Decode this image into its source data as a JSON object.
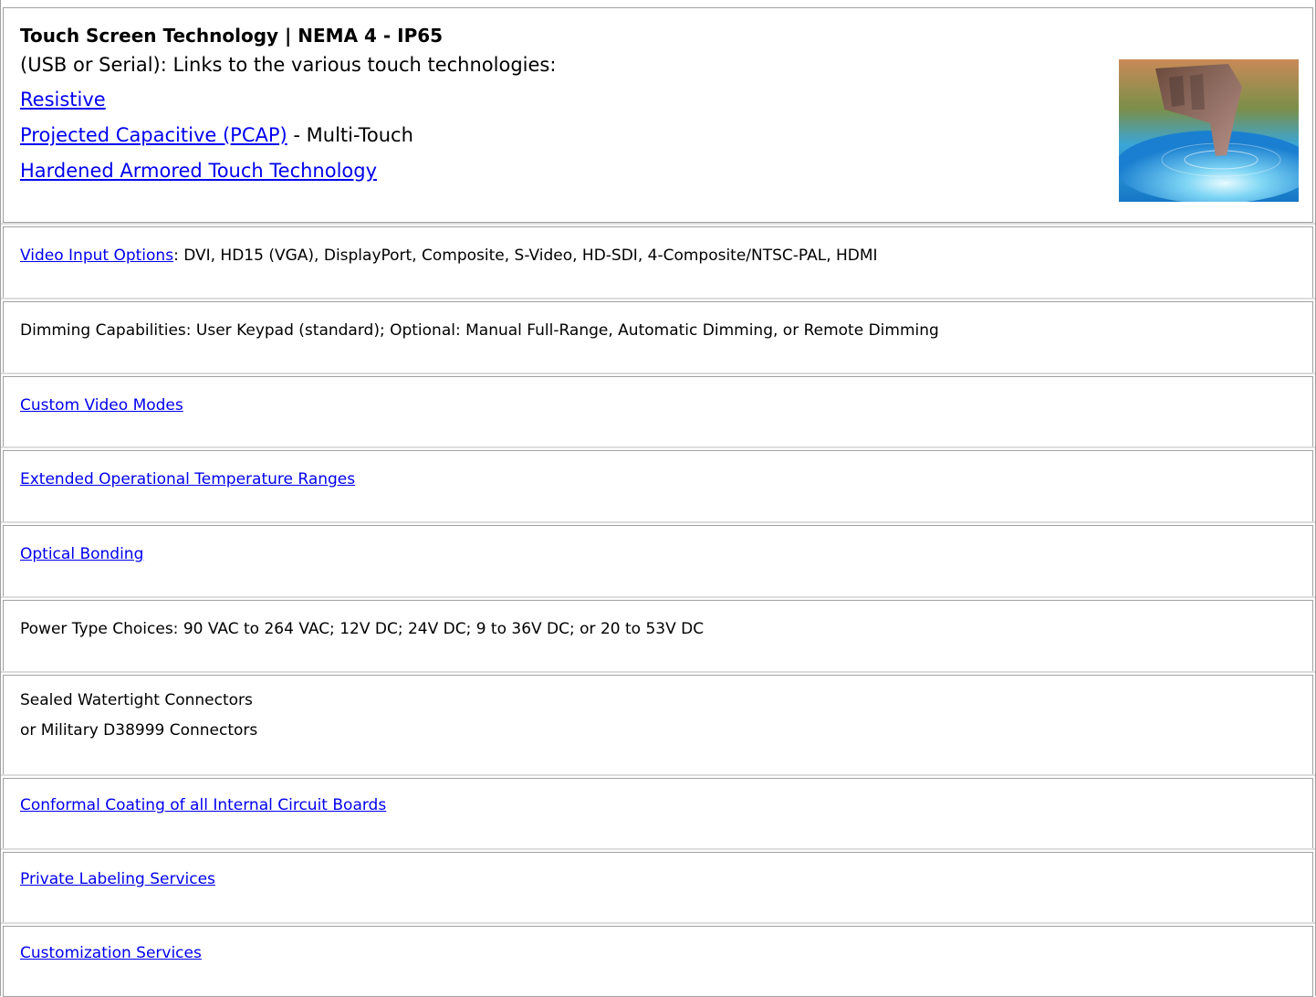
{
  "touch": {
    "title": "Touch Screen Technology | NEMA 4 - IP65",
    "intro": "(USB or Serial): Links to the various touch technologies:",
    "link_resistive": "Resistive",
    "link_pcap": "Projected Capacitive (PCAP)",
    "pcap_suffix": " - Multi-Touch",
    "link_hardened": "Hardened Armored Touch Technology"
  },
  "video": {
    "link": "Video Input Options",
    "text": ": DVI, HD15 (VGA), DisplayPort, Composite, S-Video, HD-SDI, 4-Composite/NTSC-PAL, HDMI"
  },
  "dimming": {
    "text": "Dimming Capabilities: User Keypad (standard); Optional: Manual Full-Range, Automatic Dimming, or Remote Dimming"
  },
  "custom_video": {
    "link": "Custom Video Modes"
  },
  "temperature": {
    "link": "Extended Operational Temperature Ranges"
  },
  "optical": {
    "link": "Optical Bonding"
  },
  "power": {
    "text": "Power Type Choices: 90 VAC to 264 VAC; 12V DC; 24V DC; 9 to 36V DC; or 20 to 53V DC"
  },
  "connectors": {
    "line1": "Sealed Watertight Connectors",
    "line2": "or Military D38999 Connectors"
  },
  "coating": {
    "link": "Conformal Coating of all Internal Circuit Boards"
  },
  "labeling": {
    "link": "Private Labeling Services"
  },
  "customization": {
    "link": "Customization Services"
  },
  "colors": {
    "link": "#0000ee",
    "border": "#a0a0a0"
  }
}
